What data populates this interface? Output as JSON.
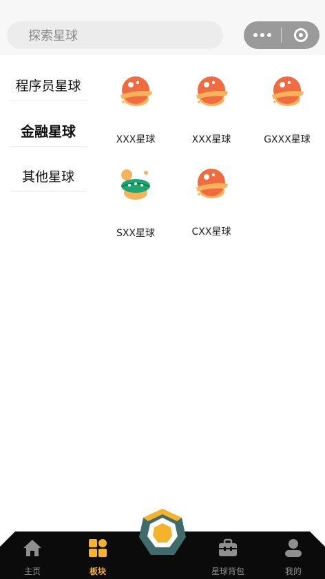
{
  "search": {
    "placeholder": "探索星球"
  },
  "sidebar": {
    "items": [
      {
        "label": "程序员星球",
        "active": false
      },
      {
        "label": "金融星球",
        "active": true
      },
      {
        "label": "其他星球",
        "active": false
      }
    ]
  },
  "planets": [
    {
      "label": "XXX星球",
      "icon": "orange-planet-icon"
    },
    {
      "label": "XXX星球",
      "icon": "orange-planet-icon"
    },
    {
      "label": "GXXX星球",
      "icon": "orange-planet-icon"
    },
    {
      "label": "SXX星球",
      "icon": "green-planet-icon"
    },
    {
      "label": "CXX星球",
      "icon": "orange-planet-icon"
    }
  ],
  "tabbar": {
    "items": [
      {
        "label": "主页",
        "icon": "home-icon",
        "active": false
      },
      {
        "label": "板块",
        "icon": "grid-icon",
        "active": true
      },
      {
        "label": "星球背包",
        "icon": "briefcase-icon",
        "active": false
      },
      {
        "label": "我的",
        "icon": "user-icon",
        "active": false
      }
    ],
    "center_icon": "planet-hexagon-icon"
  },
  "colors": {
    "accent": "#f3b32a",
    "planet_orange": "#f06b3f",
    "planet_ring": "#f7b35a",
    "planet_green": "#1ea672",
    "tabbar_bg": "#0b0b0b",
    "center_hex": "#3f6b6b"
  }
}
